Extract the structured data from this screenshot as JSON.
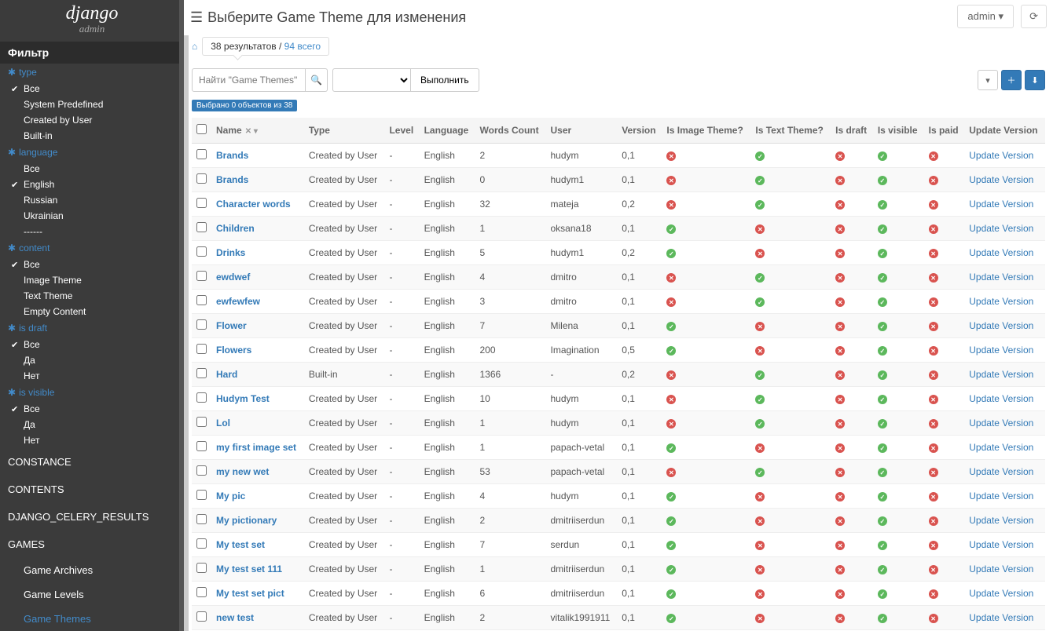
{
  "brand": {
    "title": "django",
    "subtitle": "admin"
  },
  "filter_header": "Фильтр",
  "filters": {
    "type": {
      "label": "type",
      "opts": [
        {
          "label": "Все",
          "checked": true
        },
        {
          "label": "System Predefined",
          "checked": false
        },
        {
          "label": "Created by User",
          "checked": false
        },
        {
          "label": "Built-in",
          "checked": false
        }
      ]
    },
    "language": {
      "label": "language",
      "opts": [
        {
          "label": "Все",
          "checked": false
        },
        {
          "label": "English",
          "checked": true
        },
        {
          "label": "Russian",
          "checked": false
        },
        {
          "label": "Ukrainian",
          "checked": false
        },
        {
          "label": "------",
          "checked": false
        }
      ]
    },
    "content": {
      "label": "content",
      "opts": [
        {
          "label": "Все",
          "checked": true
        },
        {
          "label": "Image Theme",
          "checked": false
        },
        {
          "label": "Text Theme",
          "checked": false
        },
        {
          "label": "Empty Content",
          "checked": false
        }
      ]
    },
    "is_draft": {
      "label": "is draft",
      "opts": [
        {
          "label": "Все",
          "checked": true
        },
        {
          "label": "Да",
          "checked": false
        },
        {
          "label": "Нет",
          "checked": false
        }
      ]
    },
    "is_visible": {
      "label": "is visible",
      "opts": [
        {
          "label": "Все",
          "checked": true
        },
        {
          "label": "Да",
          "checked": false
        },
        {
          "label": "Нет",
          "checked": false
        }
      ]
    }
  },
  "side_sections": [
    {
      "label": "CONSTANCE"
    },
    {
      "label": "CONTENTS"
    },
    {
      "label": "DJANGO_CELERY_RESULTS"
    },
    {
      "label": "GAMES"
    }
  ],
  "side_subs": [
    {
      "label": "Game Archives",
      "active": false
    },
    {
      "label": "Game Levels",
      "active": false
    },
    {
      "label": "Game Themes",
      "active": true
    }
  ],
  "header": {
    "title": "Выберите Game Theme для изменения",
    "admin": "admin",
    "crumb_count": "38 результатов",
    "crumb_sep": " / ",
    "crumb_total": "94 всего"
  },
  "toolbar": {
    "search_ph": "Найти \"Game Themes\"",
    "go_label": "Выполнить"
  },
  "selection": {
    "text": "Выбрано 0 объектов из 38"
  },
  "columns": {
    "name": "Name",
    "type": "Type",
    "level": "Level",
    "lang": "Language",
    "words": "Words Count",
    "user": "User",
    "version": "Version",
    "img": "Is Image Theme?",
    "txt": "Is Text Theme?",
    "draft": "Is draft",
    "vis": "Is visible",
    "paid": "Is paid",
    "upd": "Update Version"
  },
  "upd_label": "Update Version",
  "rows": [
    {
      "name": "Brands",
      "type": "Created by User",
      "level": "-",
      "lang": "English",
      "words": "2",
      "user": "hudym",
      "version": "0,1",
      "img": false,
      "txt": true,
      "draft": false,
      "vis": true,
      "paid": false
    },
    {
      "name": "Brands",
      "type": "Created by User",
      "level": "-",
      "lang": "English",
      "words": "0",
      "user": "hudym1",
      "version": "0,1",
      "img": false,
      "txt": true,
      "draft": false,
      "vis": true,
      "paid": false
    },
    {
      "name": "Character words",
      "type": "Created by User",
      "level": "-",
      "lang": "English",
      "words": "32",
      "user": "mateja",
      "version": "0,2",
      "img": false,
      "txt": true,
      "draft": false,
      "vis": true,
      "paid": false
    },
    {
      "name": "Children",
      "type": "Created by User",
      "level": "-",
      "lang": "English",
      "words": "1",
      "user": "oksana18",
      "version": "0,1",
      "img": true,
      "txt": false,
      "draft": false,
      "vis": true,
      "paid": false
    },
    {
      "name": "Drinks",
      "type": "Created by User",
      "level": "-",
      "lang": "English",
      "words": "5",
      "user": "hudym1",
      "version": "0,2",
      "img": true,
      "txt": false,
      "draft": false,
      "vis": true,
      "paid": false
    },
    {
      "name": "ewdwef",
      "type": "Created by User",
      "level": "-",
      "lang": "English",
      "words": "4",
      "user": "dmitro",
      "version": "0,1",
      "img": false,
      "txt": true,
      "draft": false,
      "vis": true,
      "paid": false
    },
    {
      "name": "ewfewfew",
      "type": "Created by User",
      "level": "-",
      "lang": "English",
      "words": "3",
      "user": "dmitro",
      "version": "0,1",
      "img": false,
      "txt": true,
      "draft": false,
      "vis": true,
      "paid": false
    },
    {
      "name": "Flower",
      "type": "Created by User",
      "level": "-",
      "lang": "English",
      "words": "7",
      "user": "Milena",
      "version": "0,1",
      "img": true,
      "txt": false,
      "draft": false,
      "vis": true,
      "paid": false
    },
    {
      "name": "Flowers",
      "type": "Created by User",
      "level": "-",
      "lang": "English",
      "words": "200",
      "user": "Imagination",
      "version": "0,5",
      "img": true,
      "txt": false,
      "draft": false,
      "vis": true,
      "paid": false
    },
    {
      "name": "Hard",
      "type": "Built-in",
      "level": "-",
      "lang": "English",
      "words": "1366",
      "user": "-",
      "version": "0,2",
      "img": false,
      "txt": true,
      "draft": false,
      "vis": true,
      "paid": false
    },
    {
      "name": "Hudym Test",
      "type": "Created by User",
      "level": "-",
      "lang": "English",
      "words": "10",
      "user": "hudym",
      "version": "0,1",
      "img": false,
      "txt": true,
      "draft": false,
      "vis": true,
      "paid": false
    },
    {
      "name": "Lol",
      "type": "Created by User",
      "level": "-",
      "lang": "English",
      "words": "1",
      "user": "hudym",
      "version": "0,1",
      "img": false,
      "txt": true,
      "draft": false,
      "vis": true,
      "paid": false
    },
    {
      "name": "my first image set",
      "type": "Created by User",
      "level": "-",
      "lang": "English",
      "words": "1",
      "user": "papach-vetal",
      "version": "0,1",
      "img": true,
      "txt": false,
      "draft": false,
      "vis": true,
      "paid": false
    },
    {
      "name": "my new wet",
      "type": "Created by User",
      "level": "-",
      "lang": "English",
      "words": "53",
      "user": "papach-vetal",
      "version": "0,1",
      "img": false,
      "txt": true,
      "draft": false,
      "vis": true,
      "paid": false
    },
    {
      "name": "My pic",
      "type": "Created by User",
      "level": "-",
      "lang": "English",
      "words": "4",
      "user": "hudym",
      "version": "0,1",
      "img": true,
      "txt": false,
      "draft": false,
      "vis": true,
      "paid": false
    },
    {
      "name": "My pictionary",
      "type": "Created by User",
      "level": "-",
      "lang": "English",
      "words": "2",
      "user": "dmitriiserdun",
      "version": "0,1",
      "img": true,
      "txt": false,
      "draft": false,
      "vis": true,
      "paid": false
    },
    {
      "name": "My test set",
      "type": "Created by User",
      "level": "-",
      "lang": "English",
      "words": "7",
      "user": "serdun",
      "version": "0,1",
      "img": true,
      "txt": false,
      "draft": false,
      "vis": true,
      "paid": false
    },
    {
      "name": "My test set 111",
      "type": "Created by User",
      "level": "-",
      "lang": "English",
      "words": "1",
      "user": "dmitriiserdun",
      "version": "0,1",
      "img": true,
      "txt": false,
      "draft": false,
      "vis": true,
      "paid": false
    },
    {
      "name": "My test set pict",
      "type": "Created by User",
      "level": "-",
      "lang": "English",
      "words": "6",
      "user": "dmitriiserdun",
      "version": "0,1",
      "img": true,
      "txt": false,
      "draft": false,
      "vis": true,
      "paid": false
    },
    {
      "name": "new test",
      "type": "Created by User",
      "level": "-",
      "lang": "English",
      "words": "2",
      "user": "vitalik1991911",
      "version": "0,1",
      "img": true,
      "txt": false,
      "draft": false,
      "vis": true,
      "paid": false
    }
  ]
}
